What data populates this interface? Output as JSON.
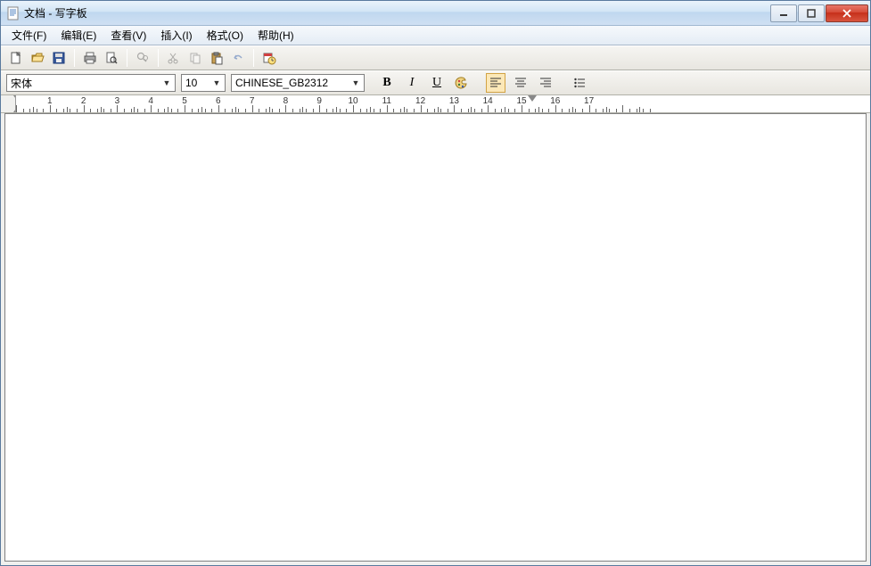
{
  "window": {
    "title": "文档 - 写字板"
  },
  "menu": {
    "items": [
      "文件(F)",
      "编辑(E)",
      "查看(V)",
      "插入(I)",
      "格式(O)",
      "帮助(H)"
    ]
  },
  "format": {
    "font": "宋体",
    "size": "10",
    "charset": "CHINESE_GB2312"
  },
  "ruler": {
    "majors": [
      1,
      2,
      3,
      4,
      5,
      6,
      7,
      8,
      9,
      10,
      11,
      12,
      13,
      14,
      15,
      16,
      17
    ],
    "right_marker_at": 15
  },
  "toolbar_icons": {
    "new": "new-file-icon",
    "open": "open-folder-icon",
    "save": "save-icon",
    "print": "print-icon",
    "preview": "print-preview-icon",
    "find": "find-icon",
    "cut": "cut-icon",
    "copy": "copy-icon",
    "paste": "paste-icon",
    "undo": "undo-icon",
    "datetime": "datetime-icon"
  },
  "format_labels": {
    "bold": "B",
    "italic": "I",
    "underline": "U"
  }
}
